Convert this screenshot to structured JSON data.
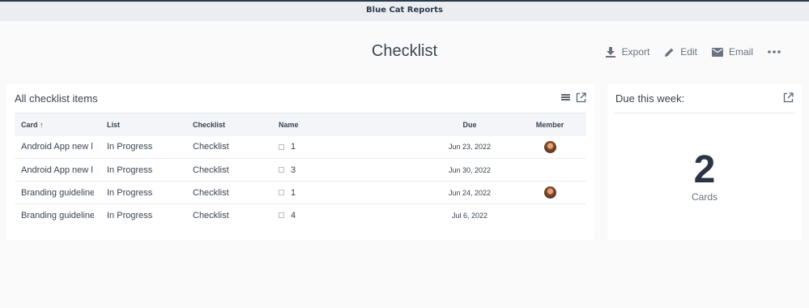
{
  "app": {
    "title": "Blue Cat Reports"
  },
  "page": {
    "title": "Checklist"
  },
  "actions": {
    "export_label": "Export",
    "edit_label": "Edit",
    "email_label": "Email",
    "icons": [
      "download-icon",
      "pencil-icon",
      "mail-icon",
      "more-icon"
    ]
  },
  "checklist_panel": {
    "title": "All checklist items",
    "icons": [
      "list-view-icon",
      "open-external-icon"
    ],
    "columns": {
      "card": "Card",
      "list": "List",
      "checklist": "Checklist",
      "name": "Name",
      "due": "Due",
      "member": "Member"
    },
    "sort": {
      "column": "Card",
      "direction": "ascending"
    },
    "rows": [
      {
        "card": "Android App new l",
        "list": "In Progress",
        "checklist": "Checklist",
        "name": "1",
        "due": "Jun 23, 2022",
        "has_member": true
      },
      {
        "card": "Android App new l",
        "list": "In Progress",
        "checklist": "Checklist",
        "name": "3",
        "due": "Jun 30, 2022",
        "has_member": false
      },
      {
        "card": "Branding guideline",
        "list": "In Progress",
        "checklist": "Checklist",
        "name": "1",
        "due": "Jun 24, 2022",
        "has_member": true
      },
      {
        "card": "Branding guideline",
        "list": "In Progress",
        "checklist": "Checklist",
        "name": "4",
        "due": "Jul 6, 2022",
        "has_member": false
      }
    ]
  },
  "due_panel": {
    "title": "Due this week:",
    "count": "2",
    "count_label": "Cards"
  },
  "colors": {
    "header_bar": "#2b3a4a",
    "accent": "#2a3445"
  }
}
